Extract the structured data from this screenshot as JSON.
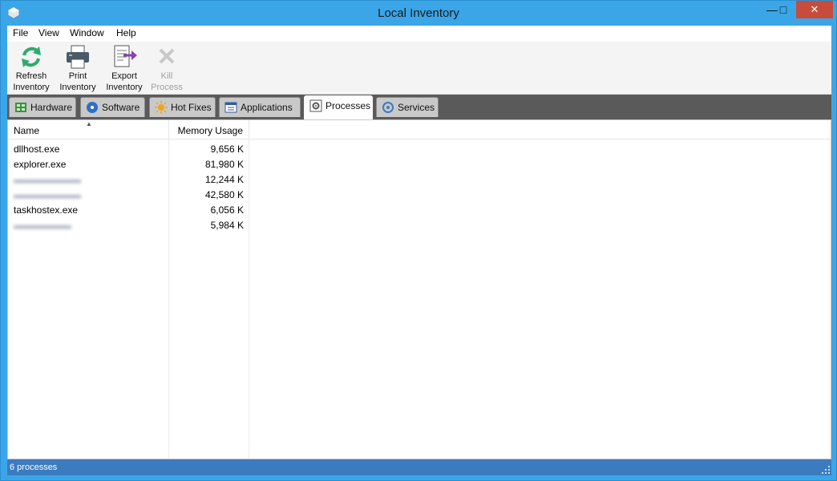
{
  "window": {
    "title": "Local Inventory"
  },
  "menu": [
    "File",
    "View",
    "Window",
    "Help"
  ],
  "toolbar": {
    "refresh": {
      "line1": "Refresh",
      "line2": "Inventory",
      "icon": "refresh-icon"
    },
    "print": {
      "line1": "Print",
      "line2": "Inventory",
      "icon": "printer-icon"
    },
    "export": {
      "line1": "Export",
      "line2": "Inventory",
      "icon": "export-icon"
    },
    "kill": {
      "line1": "Kill",
      "line2": "Process",
      "icon": "close-x-icon"
    }
  },
  "tabs": [
    {
      "label": "Hardware",
      "icon": "hardware-icon"
    },
    {
      "label": "Software",
      "icon": "software-icon"
    },
    {
      "label": "Hot Fixes",
      "icon": "hotfix-icon"
    },
    {
      "label": "Applications",
      "icon": "applications-icon"
    },
    {
      "label": "Processes",
      "icon": "gear-icon",
      "active": true
    },
    {
      "label": "Services",
      "icon": "services-icon"
    }
  ],
  "table": {
    "columns": [
      "Name",
      "Memory Usage"
    ],
    "rows": [
      {
        "name": "dllhost.exe",
        "memory": "9,656 K"
      },
      {
        "name": "explorer.exe",
        "memory": "81,980 K"
      },
      {
        "name": "",
        "memory": "12,244 K"
      },
      {
        "name": "",
        "memory": "42,580 K"
      },
      {
        "name": "taskhostex.exe",
        "memory": "6,056 K"
      },
      {
        "name": "",
        "memory": "5,984 K"
      }
    ]
  },
  "status": {
    "text": "6 processes"
  },
  "colors": {
    "titlebar": "#3aa6e8",
    "close": "#c74c3c",
    "statusbar": "#3b7bbf",
    "tabstrip": "#5a5a5a"
  }
}
